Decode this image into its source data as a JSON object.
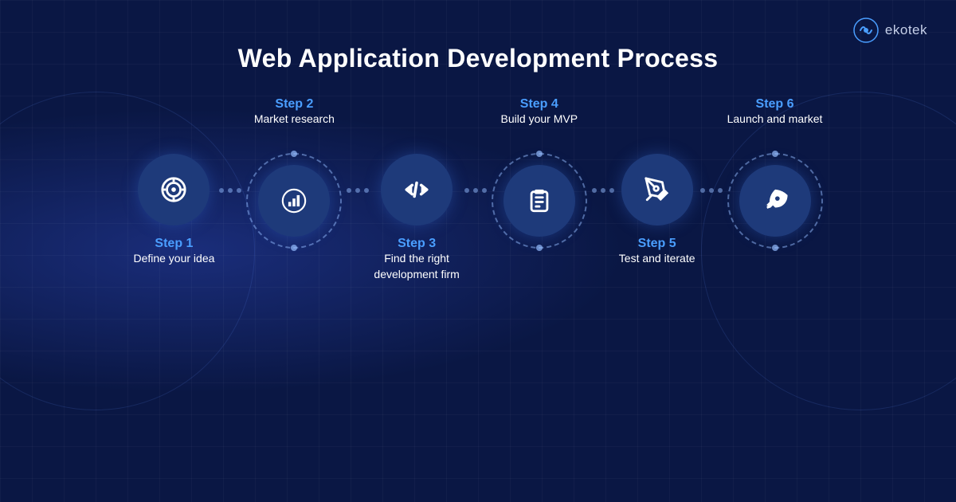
{
  "logo": {
    "name": "ekotek"
  },
  "title": "Web Application Development Process",
  "steps": [
    {
      "id": 1,
      "label": "Step 1",
      "desc": "Define your idea",
      "position": "bottom",
      "dashed": false,
      "icon": "target"
    },
    {
      "id": 2,
      "label": "Step 2",
      "desc": "Market research",
      "position": "top",
      "dashed": true,
      "icon": "chart"
    },
    {
      "id": 3,
      "label": "Step 3",
      "desc": "Find the right\ndevelopment firm",
      "position": "bottom",
      "dashed": false,
      "icon": "code"
    },
    {
      "id": 4,
      "label": "Step 4",
      "desc": "Build your MVP",
      "position": "top",
      "dashed": true,
      "icon": "clipboard"
    },
    {
      "id": 5,
      "label": "Step 5",
      "desc": "Test and iterate",
      "position": "bottom",
      "dashed": false,
      "icon": "pen"
    },
    {
      "id": 6,
      "label": "Step 6",
      "desc": "Launch and market",
      "position": "top",
      "dashed": true,
      "icon": "rocket"
    }
  ]
}
